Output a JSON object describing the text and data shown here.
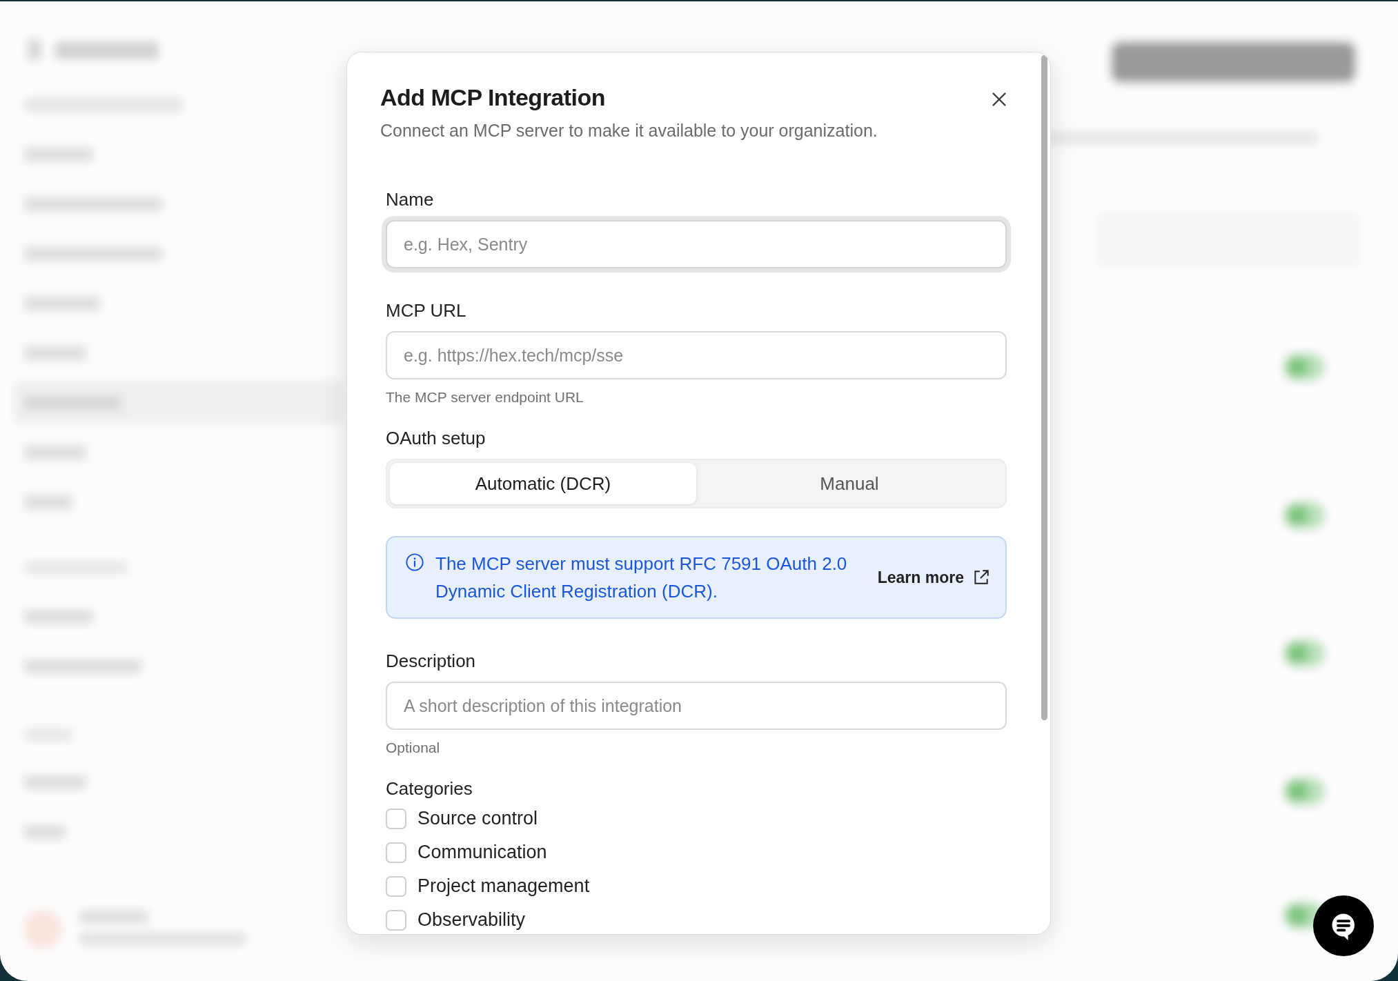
{
  "dialog": {
    "title": "Add MCP Integration",
    "subtitle": "Connect an MCP server to make it available to your organization.",
    "fields": [
      {
        "kind": "text",
        "label": "Name",
        "placeholder": "e.g. Hex, Sentry",
        "focused": true
      },
      {
        "kind": "text",
        "label": "MCP URL",
        "placeholder": "e.g. https://hex.tech/mcp/sse",
        "hint": "The MCP server endpoint URL",
        "focused": false
      },
      {
        "kind": "segmented",
        "label": "OAuth setup",
        "options": [
          {
            "label": "Automatic (DCR)",
            "selected": true
          },
          {
            "label": "Manual",
            "selected": false
          }
        ]
      },
      {
        "kind": "notice",
        "text": "The MCP server must support RFC 7591 OAuth 2.0 Dynamic Client Registration (DCR).",
        "link": "Learn more"
      },
      {
        "kind": "text",
        "label": "Description",
        "placeholder": "A short description of this integration",
        "hint": "Optional",
        "focused": false
      },
      {
        "kind": "checklist",
        "label": "Categories",
        "options": [
          {
            "label": "Source control",
            "checked": false
          },
          {
            "label": "Communication",
            "checked": false
          },
          {
            "label": "Project management",
            "checked": false
          },
          {
            "label": "Observability",
            "checked": false
          }
        ]
      }
    ]
  }
}
